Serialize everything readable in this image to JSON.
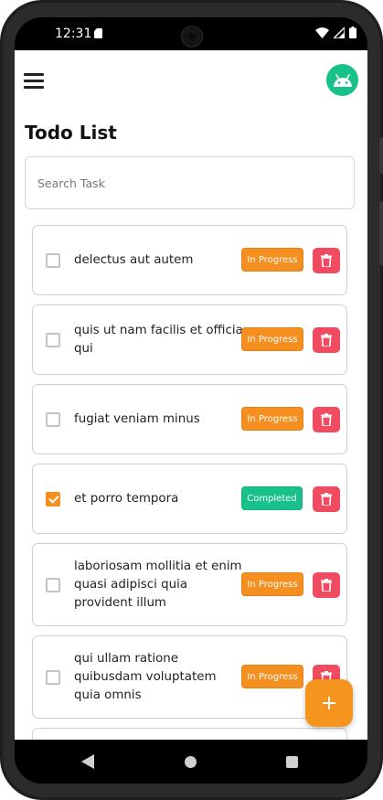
{
  "status_bar": {
    "time": "12:31"
  },
  "header": {
    "menu_icon": "hamburger-menu-icon",
    "avatar_icon": "android-icon",
    "avatar_color": "#17C189"
  },
  "page_title": "Todo List",
  "search": {
    "placeholder": "Search Task",
    "value": ""
  },
  "todos": [
    {
      "text": "delectus aut autem",
      "completed": false,
      "status": "In Progress"
    },
    {
      "text": "quis ut nam facilis et officia qui",
      "completed": false,
      "status": "In Progress"
    },
    {
      "text": "fugiat veniam minus",
      "completed": false,
      "status": "In Progress"
    },
    {
      "text": "et porro tempora",
      "completed": true,
      "status": "Completed"
    },
    {
      "text": "laboriosam mollitia et enim quasi adipisci quia provident illum",
      "completed": false,
      "status": "In Progress"
    },
    {
      "text": "qui ullam ratione quibusdam voluptatem quia omnis",
      "completed": false,
      "status": "In Progress"
    }
  ],
  "fab": {
    "icon": "plus-icon",
    "color": "#F5951E"
  },
  "colors": {
    "in_progress": "#F58F1F",
    "completed": "#17C189",
    "delete": "#F04B60"
  },
  "nav_bar": {
    "back_icon": "back-triangle-icon",
    "home_icon": "home-circle-icon",
    "recents_icon": "recents-square-icon"
  }
}
